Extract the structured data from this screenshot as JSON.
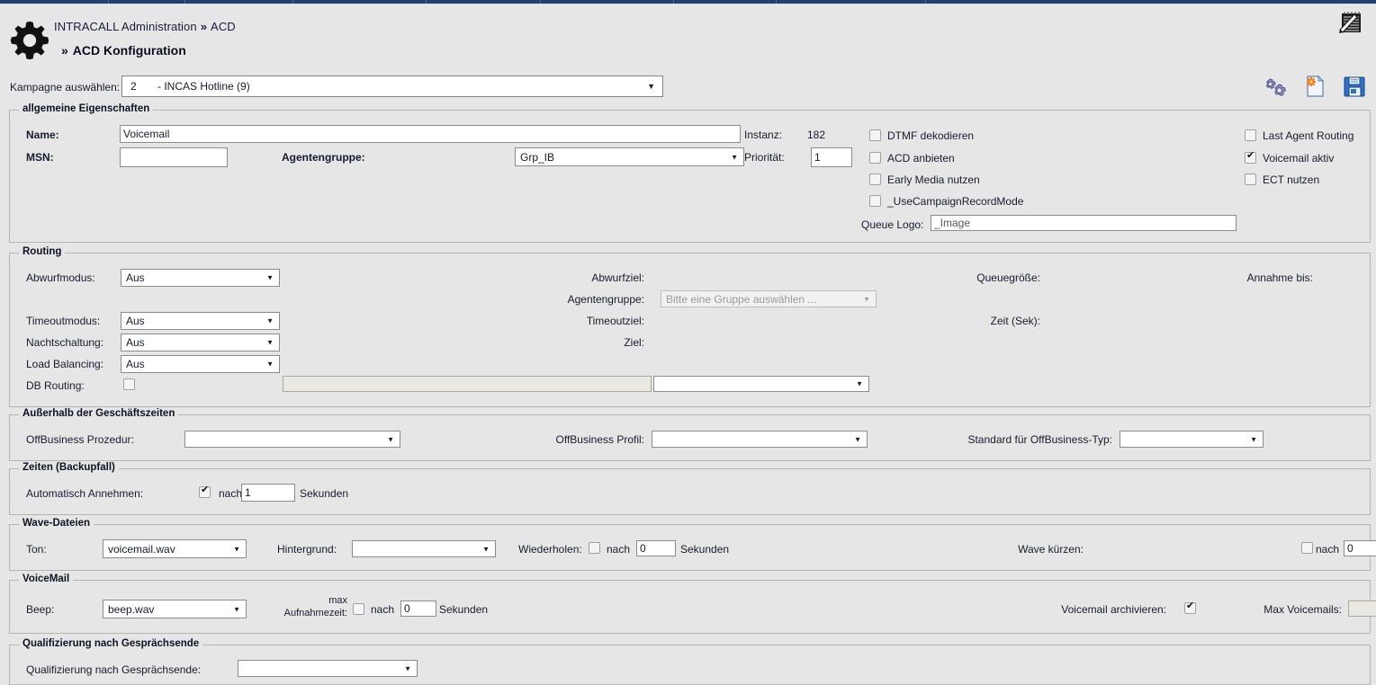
{
  "window": {
    "accent_color": "#1f4070",
    "background_color": "#e6e6e6"
  },
  "header": {
    "breadcrumb_root": "INTRACALL Administration",
    "breadcrumb_sep": "»",
    "breadcrumb_current": "ACD",
    "page_title": "ACD Konfiguration",
    "page_title_sep": "»",
    "logo_icon": "gear-icon",
    "notebook_icon": "notepad-pencil-icon"
  },
  "campaign": {
    "label": "Kampagne auswählen:",
    "value_number": "2",
    "value_name": "- INCAS Hotline (9)",
    "arrow": "▼"
  },
  "toolbar": {
    "settings_icon": "gears-icon",
    "new_document_icon": "new-document-icon",
    "save_icon": "save-floppy-icon"
  },
  "general": {
    "legend": "allgemeine Eigenschaften",
    "name_label": "Name:",
    "name_value": "Voicemail",
    "msn_label": "MSN:",
    "msn_value": "",
    "agentgroup_label": "Agentengruppe:",
    "agentgroup_value": "Grp_IB",
    "instanz_label": "Instanz:",
    "instanz_value": "182",
    "prioritaet_label": "Priorität:",
    "prioritaet_value": "1",
    "checkboxes": [
      {
        "label": "DTMF dekodieren",
        "checked": false
      },
      {
        "label": "ACD anbieten",
        "checked": false
      },
      {
        "label": "Early Media nutzen",
        "checked": false
      },
      {
        "label": "_UseCampaignRecordMode",
        "checked": false
      }
    ],
    "right_checkboxes": [
      {
        "label": "Last Agent Routing",
        "checked": false
      },
      {
        "label": "Voicemail aktiv",
        "checked": true
      },
      {
        "label": "ECT nutzen",
        "checked": false
      }
    ],
    "queue_logo_label": "Queue Logo:",
    "queue_logo_value": "_Image"
  },
  "routing": {
    "legend": "Routing",
    "abwurfmodus_label": "Abwurfmodus:",
    "abwurfmodus_value": "Aus",
    "abwurfziel_label": "Abwurfziel:",
    "agentengruppe_label": "Agentengruppe:",
    "agentengruppe_placeholder": "Bitte eine Gruppe auswählen ...",
    "queuegroesse_label": "Queuegröße:",
    "annahme_bis_label": "Annahme bis:",
    "timeoutmodus_label": "Timeoutmodus:",
    "timeoutmodus_value": "Aus",
    "timeoutziel_label": "Timeoutziel:",
    "zeit_sek_label": "Zeit (Sek):",
    "nachtschaltung_label": "Nachtschaltung:",
    "nachtschaltung_value": "Aus",
    "ziel_label": "Ziel:",
    "loadbalancing_label": "Load Balancing:",
    "loadbalancing_value": "Aus",
    "dbrouting_label": "DB Routing:",
    "dbrouting_checked": false,
    "dbrouting_text": "",
    "dbrouting_select_value": "",
    "arrow": "▼"
  },
  "offbusiness": {
    "legend": "Außerhalb der Geschäftszeiten",
    "prozedur_label": "OffBusiness Prozedur:",
    "prozedur_value": "",
    "profil_label": "OffBusiness Profil:",
    "profil_value": "",
    "standard_label": "Standard für OffBusiness-Typ:",
    "standard_value": ""
  },
  "times": {
    "legend": "Zeiten (Backupfall)",
    "auto_answer_label": "Automatisch Annehmen:",
    "auto_answer_checked": true,
    "nach_label": "nach",
    "seconds_value": "1",
    "sekunden_label": "Sekunden"
  },
  "wave": {
    "legend": "Wave-Dateien",
    "ton_label": "Ton:",
    "ton_value": "voicemail.wav",
    "hintergrund_label": "Hintergrund:",
    "hintergrund_value": "",
    "wiederholen_label": "Wiederholen:",
    "wiederholen_checked": false,
    "nach_label": "nach",
    "wiederholen_seconds": "0",
    "sekunden_label": "Sekunden",
    "wave_kuerzen_label": "Wave kürzen:",
    "wave_kuerzen_checked": false,
    "wave_kuerzen_nach": "nach",
    "wave_kuerzen_seconds": "0"
  },
  "voicemail": {
    "legend": "VoiceMail",
    "beep_label": "Beep:",
    "beep_value": "beep.wav",
    "max_label_top": "max",
    "max_label_bottom": "Aufnahmezeit:",
    "max_checked": false,
    "nach_label": "nach",
    "max_seconds": "0",
    "sekunden_label": "Sekunden",
    "archivieren_label": "Voicemail archivieren:",
    "archivieren_checked": true,
    "max_voicemails_label": "Max Voicemails:",
    "max_voicemails_value": ""
  },
  "qualification": {
    "legend": "Qualifizierung nach Gesprächsende",
    "label": "Qualifizierung nach Gesprächsende:",
    "value": ""
  }
}
